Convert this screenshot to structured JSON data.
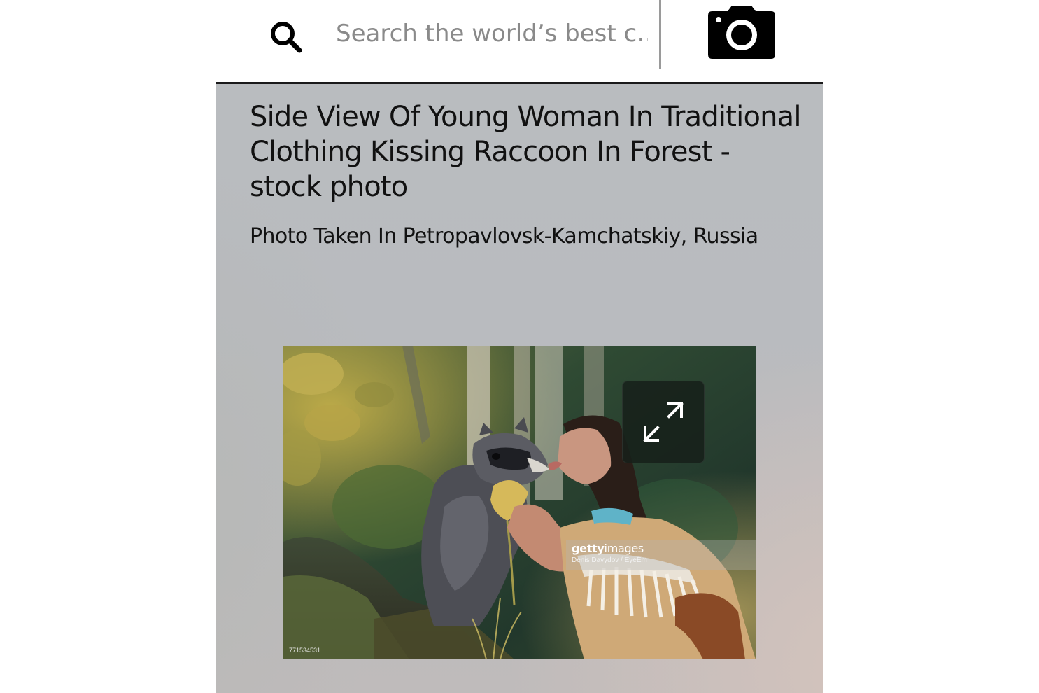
{
  "header": {
    "search": {
      "placeholder": "Search the world’s best c…"
    },
    "icons": {
      "search": "search-icon",
      "camera": "camera-icon"
    }
  },
  "photo": {
    "title": "Side View Of Young Woman In Traditional Clothing Kissing Raccoon In Forest - stock photo",
    "location": "Photo Taken In Petropavlovsk-Kamchatskiy, Russia",
    "watermark": {
      "brand_bold": "getty",
      "brand_light": "images",
      "credit": "Denis Davydov / EyeEm"
    },
    "image_id": "771534531",
    "expand_icon": "expand-arrows-icon"
  }
}
